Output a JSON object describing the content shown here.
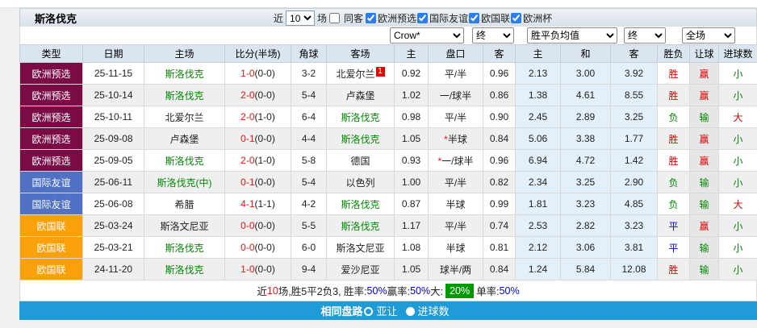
{
  "colors": {
    "league_maroon": "#7a0b45",
    "league_blue": "#5071c4",
    "league_orange": "#f9a10a",
    "avg_cell_bg": "#e3eff9",
    "footer_bar": "#1f9bd7",
    "win_red": "#dd0000",
    "lose_green": "#008800",
    "draw_blue": "#0000dd",
    "summary_green_box": "#009900"
  },
  "title": "斯洛伐克",
  "topbar": {
    "near_label": "近",
    "count_value": "10",
    "matches_label": "场",
    "same_away_label": "同客",
    "same_away_checked": false,
    "filters": [
      {
        "label": "欧洲预选",
        "checked": true
      },
      {
        "label": "国际友谊",
        "checked": true
      },
      {
        "label": "欧国联",
        "checked": true
      },
      {
        "label": "欧洲杯",
        "checked": true
      }
    ]
  },
  "controls": {
    "bookmaker": "Crow*",
    "handicap_time": "终",
    "odds_type": "胜平负均值",
    "odds_time": "终",
    "scope": "全场"
  },
  "table": {
    "headers": [
      "类型",
      "日期",
      "主场",
      "比分(半场)",
      "角球",
      "客场",
      "主",
      "盘口",
      "客",
      "主",
      "和",
      "客",
      "胜负",
      "让球",
      "进球数"
    ],
    "rows": [
      {
        "type": "欧洲预选",
        "type_color": "maroon",
        "date": "25-11-15",
        "home": "斯洛伐克",
        "home_color": "green",
        "score": "1-0",
        "half": "(0-0)",
        "corner": "3-2",
        "away": "北爱尔兰",
        "away_color": "black",
        "away_badge": "1",
        "odds_home": "0.92",
        "handicap": "平/半",
        "handicap_star": false,
        "odds_away": "0.96",
        "avg_home": "2.13",
        "avg_draw": "3.00",
        "avg_away": "3.92",
        "result": {
          "text": "胜",
          "color": "red"
        },
        "handicap_result": {
          "text": "赢",
          "color": "red"
        },
        "goals_result": {
          "text": "小",
          "color": "green"
        }
      },
      {
        "type": "欧洲预选",
        "type_color": "maroon",
        "date": "25-10-14",
        "home": "斯洛伐克",
        "home_color": "green",
        "score": "2-0",
        "half": "(0-0)",
        "corner": "5-4",
        "away": "卢森堡",
        "away_color": "black",
        "away_badge": "",
        "odds_home": "1.02",
        "handicap": "一/球半",
        "handicap_star": false,
        "odds_away": "0.86",
        "avg_home": "1.38",
        "avg_draw": "4.61",
        "avg_away": "8.55",
        "result": {
          "text": "胜",
          "color": "red"
        },
        "handicap_result": {
          "text": "赢",
          "color": "red"
        },
        "goals_result": {
          "text": "小",
          "color": "green"
        }
      },
      {
        "type": "欧洲预选",
        "type_color": "maroon",
        "date": "25-10-11",
        "home": "北爱尔兰",
        "home_color": "black",
        "score": "2-0",
        "half": "(1-0)",
        "corner": "6-4",
        "away": "斯洛伐克",
        "away_color": "green",
        "away_badge": "",
        "odds_home": "0.98",
        "handicap": "平/半",
        "handicap_star": false,
        "odds_away": "0.90",
        "avg_home": "2.45",
        "avg_draw": "2.89",
        "avg_away": "3.25",
        "result": {
          "text": "负",
          "color": "green"
        },
        "handicap_result": {
          "text": "输",
          "color": "green"
        },
        "goals_result": {
          "text": "大",
          "color": "red"
        }
      },
      {
        "type": "欧洲预选",
        "type_color": "maroon",
        "date": "25-09-08",
        "home": "卢森堡",
        "home_color": "black",
        "score": "0-1",
        "half": "(0-0)",
        "corner": "4-4",
        "away": "斯洛伐克",
        "away_color": "green",
        "away_badge": "",
        "odds_home": "1.05",
        "handicap": "半球",
        "handicap_star": true,
        "odds_away": "0.84",
        "avg_home": "5.06",
        "avg_draw": "3.38",
        "avg_away": "1.77",
        "result": {
          "text": "胜",
          "color": "red"
        },
        "handicap_result": {
          "text": "赢",
          "color": "red"
        },
        "goals_result": {
          "text": "小",
          "color": "green"
        }
      },
      {
        "type": "欧洲预选",
        "type_color": "maroon",
        "date": "25-09-05",
        "home": "斯洛伐克",
        "home_color": "green",
        "score": "2-0",
        "half": "(1-0)",
        "corner": "5-8",
        "away": "德国",
        "away_color": "black",
        "away_badge": "",
        "odds_home": "0.93",
        "handicap": "一/球半",
        "handicap_star": true,
        "odds_away": "0.96",
        "avg_home": "6.94",
        "avg_draw": "4.72",
        "avg_away": "1.42",
        "result": {
          "text": "胜",
          "color": "red"
        },
        "handicap_result": {
          "text": "赢",
          "color": "red"
        },
        "goals_result": {
          "text": "小",
          "color": "green"
        }
      },
      {
        "type": "国际友谊",
        "type_color": "blue",
        "date": "25-06-11",
        "home": "斯洛伐克(中)",
        "home_color": "green",
        "score": "0-1",
        "half": "(0-0)",
        "corner": "5-4",
        "away": "以色列",
        "away_color": "black",
        "away_badge": "",
        "odds_home": "1.00",
        "handicap": "平/半",
        "handicap_star": false,
        "odds_away": "0.82",
        "avg_home": "2.34",
        "avg_draw": "3.25",
        "avg_away": "2.90",
        "result": {
          "text": "负",
          "color": "green"
        },
        "handicap_result": {
          "text": "输",
          "color": "green"
        },
        "goals_result": {
          "text": "小",
          "color": "green"
        }
      },
      {
        "type": "国际友谊",
        "type_color": "blue",
        "date": "25-06-08",
        "home": "希腊",
        "home_color": "black",
        "score": "4-1",
        "half": "(1-1)",
        "corner": "4-2",
        "away": "斯洛伐克",
        "away_color": "green",
        "away_badge": "",
        "odds_home": "0.87",
        "handicap": "半球",
        "handicap_star": false,
        "odds_away": "0.99",
        "avg_home": "1.81",
        "avg_draw": "3.23",
        "avg_away": "4.85",
        "result": {
          "text": "负",
          "color": "green"
        },
        "handicap_result": {
          "text": "输",
          "color": "green"
        },
        "goals_result": {
          "text": "大",
          "color": "red"
        }
      },
      {
        "type": "欧国联",
        "type_color": "orange",
        "date": "25-03-24",
        "home": "斯洛文尼亚",
        "home_color": "black",
        "score": "0-0",
        "half": "(0-0)",
        "corner": "5-5",
        "away": "斯洛伐克",
        "away_color": "green",
        "away_badge": "",
        "odds_home": "1.17",
        "handicap": "平/半",
        "handicap_star": false,
        "odds_away": "0.74",
        "avg_home": "2.53",
        "avg_draw": "2.82",
        "avg_away": "3.23",
        "result": {
          "text": "平",
          "color": "blue"
        },
        "handicap_result": {
          "text": "赢",
          "color": "red"
        },
        "goals_result": {
          "text": "小",
          "color": "green"
        }
      },
      {
        "type": "欧国联",
        "type_color": "orange",
        "date": "25-03-21",
        "home": "斯洛伐克",
        "home_color": "green",
        "score": "0-0",
        "half": "(0-0)",
        "corner": "6-0",
        "away": "斯洛文尼亚",
        "away_color": "black",
        "away_badge": "",
        "odds_home": "1.08",
        "handicap": "半球",
        "handicap_star": false,
        "odds_away": "0.81",
        "avg_home": "2.12",
        "avg_draw": "3.06",
        "avg_away": "3.81",
        "result": {
          "text": "平",
          "color": "blue"
        },
        "handicap_result": {
          "text": "输",
          "color": "green"
        },
        "goals_result": {
          "text": "小",
          "color": "green"
        }
      },
      {
        "type": "欧国联",
        "type_color": "orange",
        "date": "24-11-20",
        "home": "斯洛伐克",
        "home_color": "green",
        "score": "1-0",
        "half": "(0-0)",
        "corner": "9-4",
        "away": "爱沙尼亚",
        "away_color": "black",
        "away_badge": "",
        "odds_home": "1.05",
        "handicap": "球半/两",
        "handicap_star": false,
        "odds_away": "0.84",
        "avg_home": "1.24",
        "avg_draw": "5.84",
        "avg_away": "12.08",
        "result": {
          "text": "胜",
          "color": "red"
        },
        "handicap_result": {
          "text": "输",
          "color": "green"
        },
        "goals_result": {
          "text": "小",
          "color": "green"
        }
      }
    ]
  },
  "summary": {
    "segments": [
      {
        "text": "近",
        "style": "black"
      },
      {
        "text": "10",
        "style": "red"
      },
      {
        "text": "场,胜5平2负3, 胜率:",
        "style": "black"
      },
      {
        "text": "50%",
        "style": "blue"
      },
      {
        "text": " 赢率:",
        "style": "black"
      },
      {
        "text": "50%",
        "style": "blue"
      },
      {
        "text": " 大:",
        "style": "black"
      },
      {
        "text": "20%",
        "style": "greenbox"
      },
      {
        "text": " 单率:",
        "style": "black"
      },
      {
        "text": "50%",
        "style": "blue"
      }
    ]
  },
  "footer": {
    "title": "相同盘路",
    "options": [
      {
        "label": "亚让",
        "checked": false
      },
      {
        "label": "进球数",
        "checked": true
      }
    ]
  }
}
